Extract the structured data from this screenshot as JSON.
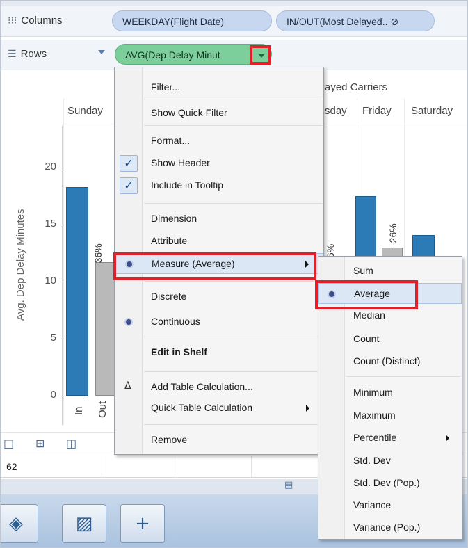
{
  "shelves": {
    "columns": {
      "label": "Columns",
      "pills": [
        "WEEKDAY(Flight Date)",
        "IN/OUT(Most Delayed.. ⊘"
      ]
    },
    "rows": {
      "label": "Rows",
      "pill": "AVG(Dep Delay Minut"
    }
  },
  "chart": {
    "top_title": "ayed Carriers",
    "days": [
      "Sunday",
      "sday",
      "Friday",
      "Saturday"
    ],
    "y_axis_label": "Avg. Dep Delay Minutes",
    "y_ticks": [
      "20",
      "15",
      "10",
      "5",
      "0"
    ],
    "x_labels": [
      "In",
      "Out"
    ],
    "bar_labels": [
      "-36%",
      "6%",
      "-26%"
    ]
  },
  "chart_data": {
    "type": "bar",
    "title": "",
    "ylabel": "Avg. Dep Delay Minutes",
    "ylim": [
      0,
      24
    ],
    "categories": [
      "Sunday In",
      "Sunday Out",
      "Friday In",
      "Friday Out",
      "Saturday In"
    ],
    "series": [
      {
        "values": [
          18.3,
          11.7,
          17.5,
          13.0,
          14.1
        ]
      }
    ]
  },
  "context_menu": {
    "items": [
      {
        "label": "Filter...",
        "type": "plain"
      },
      {
        "label": "Show Quick Filter",
        "type": "plain"
      },
      {
        "label": "Format...",
        "type": "plain"
      },
      {
        "label": "Show Header",
        "type": "check"
      },
      {
        "label": "Include in Tooltip",
        "type": "check"
      },
      {
        "label": "Dimension",
        "type": "plain"
      },
      {
        "label": "Attribute",
        "type": "plain"
      },
      {
        "label": "Measure (Average)",
        "type": "radio-sub"
      },
      {
        "label": "Discrete",
        "type": "plain"
      },
      {
        "label": "Continuous",
        "type": "radio"
      },
      {
        "label": "Edit in Shelf",
        "type": "bold"
      },
      {
        "label": "Add Table Calculation...",
        "type": "delta"
      },
      {
        "label": "Quick Table Calculation",
        "type": "sub"
      },
      {
        "label": "Remove",
        "type": "plain"
      }
    ]
  },
  "submenu": {
    "items": [
      {
        "label": "Sum"
      },
      {
        "label": "Average"
      },
      {
        "label": "Median"
      },
      {
        "label": "Count"
      },
      {
        "label": "Count (Distinct)"
      },
      {
        "label": "Minimum"
      },
      {
        "label": "Maximum"
      },
      {
        "label": "Percentile"
      },
      {
        "label": "Std. Dev"
      },
      {
        "label": "Std. Dev (Pop.)"
      },
      {
        "label": "Variance"
      },
      {
        "label": "Variance (Pop.)"
      }
    ]
  },
  "status": {
    "value": "62"
  },
  "colors": {
    "bar_blue": "#2c7bb6",
    "bar_gray": "#b9b9b9",
    "highlight_red": "#e3202a",
    "pill_green": "#7ccf9b",
    "pill_blue": "#c6d7ef"
  }
}
